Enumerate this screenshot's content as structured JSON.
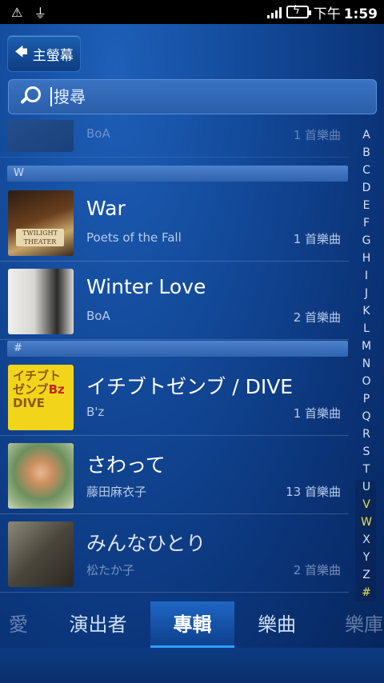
{
  "status": {
    "time_period": "下午",
    "time": "1:59",
    "icons": [
      "warning-icon",
      "usb-icon",
      "signal-icon",
      "battery-charging-icon"
    ]
  },
  "home_button": {
    "label": "主螢幕",
    "icon": "arrow-left-icon"
  },
  "search": {
    "placeholder": "搜尋",
    "value": ""
  },
  "sections": {
    "w": "W",
    "hash": "#"
  },
  "albums": [
    {
      "title": "",
      "artist": "BoA",
      "count": "1 首樂曲"
    },
    {
      "title": "War",
      "artist": "Poets of the Fall",
      "count": "1 首樂曲"
    },
    {
      "title": "Winter Love",
      "artist": "BoA",
      "count": "2 首樂曲"
    },
    {
      "title": "イチブトゼンブ / DIVE",
      "artist": "B'z",
      "count": "1 首樂曲"
    },
    {
      "title": "さわって",
      "artist": "藤田麻衣子",
      "count": "13 首樂曲"
    },
    {
      "title": "みんなひとり",
      "artist": "松たか子",
      "count": "2 首樂曲"
    }
  ],
  "index_letters": [
    "A",
    "B",
    "C",
    "D",
    "E",
    "F",
    "G",
    "H",
    "I",
    "J",
    "K",
    "L",
    "M",
    "N",
    "O",
    "P",
    "Q",
    "R",
    "S",
    "T",
    "U",
    "V",
    "W",
    "X",
    "Y",
    "Z",
    "#"
  ],
  "index_highlight": [
    "V",
    "W",
    "#"
  ],
  "tabs": {
    "left_edge": "愛",
    "artists": "演出者",
    "albums": "專輯",
    "songs": "樂曲",
    "right_edge": "樂庫"
  },
  "colors": {
    "accent": "#2ca0ff",
    "highlight": "#e8e04a"
  }
}
